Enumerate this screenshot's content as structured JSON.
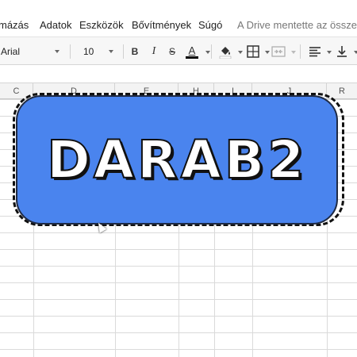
{
  "menu": {
    "items": [
      "mázás",
      "Adatok",
      "Eszközök",
      "Bővítmények",
      "Súgó"
    ],
    "status": "A Drive mentette az összes m"
  },
  "toolbar": {
    "font": "Arial",
    "size": "10",
    "bold": "B",
    "italic": "I",
    "strike": "S",
    "text_color": "A",
    "text_color_bar": "#000000"
  },
  "columns": [
    "C",
    "D",
    "E",
    "H",
    "I",
    "J",
    "R"
  ],
  "badge": {
    "text": "DARAB2",
    "color": "#4a84ee"
  }
}
